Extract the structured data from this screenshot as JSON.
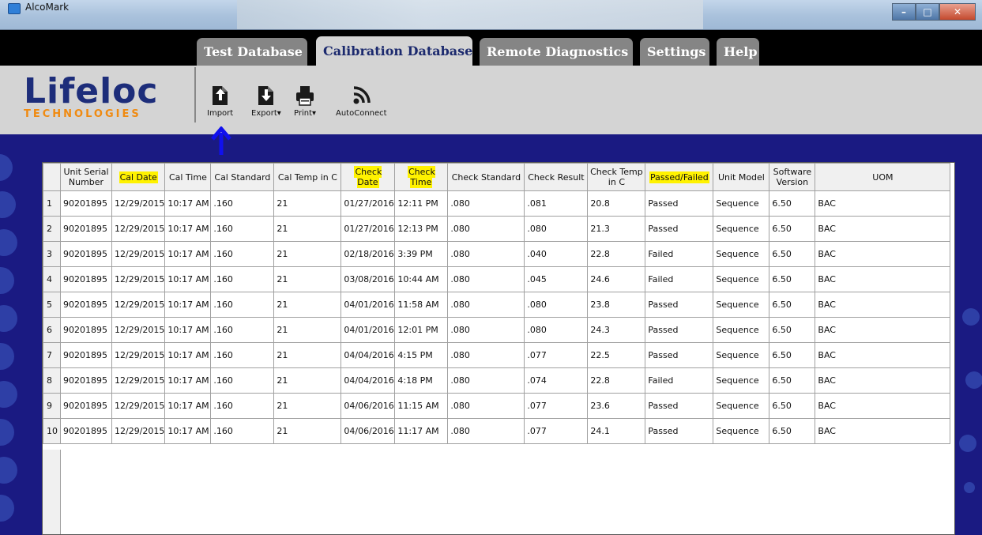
{
  "window": {
    "title": "AlcoMark"
  },
  "tabs": [
    {
      "label": "Test Database",
      "active": false
    },
    {
      "label": "Calibration Database",
      "active": true
    },
    {
      "label": "Remote Diagnostics",
      "active": false
    },
    {
      "label": "Settings",
      "active": false
    },
    {
      "label": "Help",
      "active": false
    }
  ],
  "logo": {
    "main": "Lifeloc",
    "sub": "TECHNOLOGIES"
  },
  "toolbar": {
    "import_label": "Import",
    "export_label": "Export",
    "print_label": "Print",
    "autoconnect_label": "AutoConnect"
  },
  "table": {
    "headers": [
      "",
      "Unit Serial Number",
      "Cal Date",
      "Cal Time",
      "Cal Standard",
      "Cal Temp in C",
      "Check Date",
      "Check Time",
      "Check Standard",
      "Check Result",
      "Check Temp in C",
      "Passed/Failed",
      "Unit Model",
      "Software Version",
      "UOM"
    ],
    "highlighted_headers": [
      "Cal Date",
      "Check Date",
      "Check Time",
      "Passed/Failed"
    ],
    "rows": [
      [
        "1",
        "90201895",
        "12/29/2015",
        "10:17 AM",
        ".160",
        "21",
        "01/27/2016",
        "12:11 PM",
        ".080",
        ".081",
        "20.8",
        "Passed",
        "Sequence",
        "6.50",
        "BAC"
      ],
      [
        "2",
        "90201895",
        "12/29/2015",
        "10:17 AM",
        ".160",
        "21",
        "01/27/2016",
        "12:13 PM",
        ".080",
        ".080",
        "21.3",
        "Passed",
        "Sequence",
        "6.50",
        "BAC"
      ],
      [
        "3",
        "90201895",
        "12/29/2015",
        "10:17 AM",
        ".160",
        "21",
        "02/18/2016",
        "3:39  PM",
        ".080",
        ".040",
        "22.8",
        "Failed",
        "Sequence",
        "6.50",
        "BAC"
      ],
      [
        "4",
        "90201895",
        "12/29/2015",
        "10:17 AM",
        ".160",
        "21",
        "03/08/2016",
        "10:44 AM",
        ".080",
        ".045",
        "24.6",
        "Failed",
        "Sequence",
        "6.50",
        "BAC"
      ],
      [
        "5",
        "90201895",
        "12/29/2015",
        "10:17 AM",
        ".160",
        "21",
        "04/01/2016",
        "11:58 AM",
        ".080",
        ".080",
        "23.8",
        "Passed",
        "Sequence",
        "6.50",
        "BAC"
      ],
      [
        "6",
        "90201895",
        "12/29/2015",
        "10:17 AM",
        ".160",
        "21",
        "04/01/2016",
        "12:01 PM",
        ".080",
        ".080",
        "24.3",
        "Passed",
        "Sequence",
        "6.50",
        "BAC"
      ],
      [
        "7",
        "90201895",
        "12/29/2015",
        "10:17 AM",
        ".160",
        "21",
        "04/04/2016",
        "4:15  PM",
        ".080",
        ".077",
        "22.5",
        "Passed",
        "Sequence",
        "6.50",
        "BAC"
      ],
      [
        "8",
        "90201895",
        "12/29/2015",
        "10:17 AM",
        ".160",
        "21",
        "04/04/2016",
        "4:18  PM",
        ".080",
        ".074",
        "22.8",
        "Failed",
        "Sequence",
        "6.50",
        "BAC"
      ],
      [
        "9",
        "90201895",
        "12/29/2015",
        "10:17 AM",
        ".160",
        "21",
        "04/06/2016",
        "11:15 AM",
        ".080",
        ".077",
        "23.6",
        "Passed",
        "Sequence",
        "6.50",
        "BAC"
      ],
      [
        "10",
        "90201895",
        "12/29/2015",
        "10:17 AM",
        ".160",
        "21",
        "04/06/2016",
        "11:17 AM",
        ".080",
        ".077",
        "24.1",
        "Passed",
        "Sequence",
        "6.50",
        "BAC"
      ]
    ]
  },
  "colors": {
    "background": "#1a1a82",
    "tab_inactive": "#858585",
    "tab_active": "#d4d4d4",
    "header_highlight": "#fff200",
    "logo_blue": "#1d2d7a",
    "logo_orange": "#f08a10",
    "annotation_arrow": "#1010ee"
  }
}
